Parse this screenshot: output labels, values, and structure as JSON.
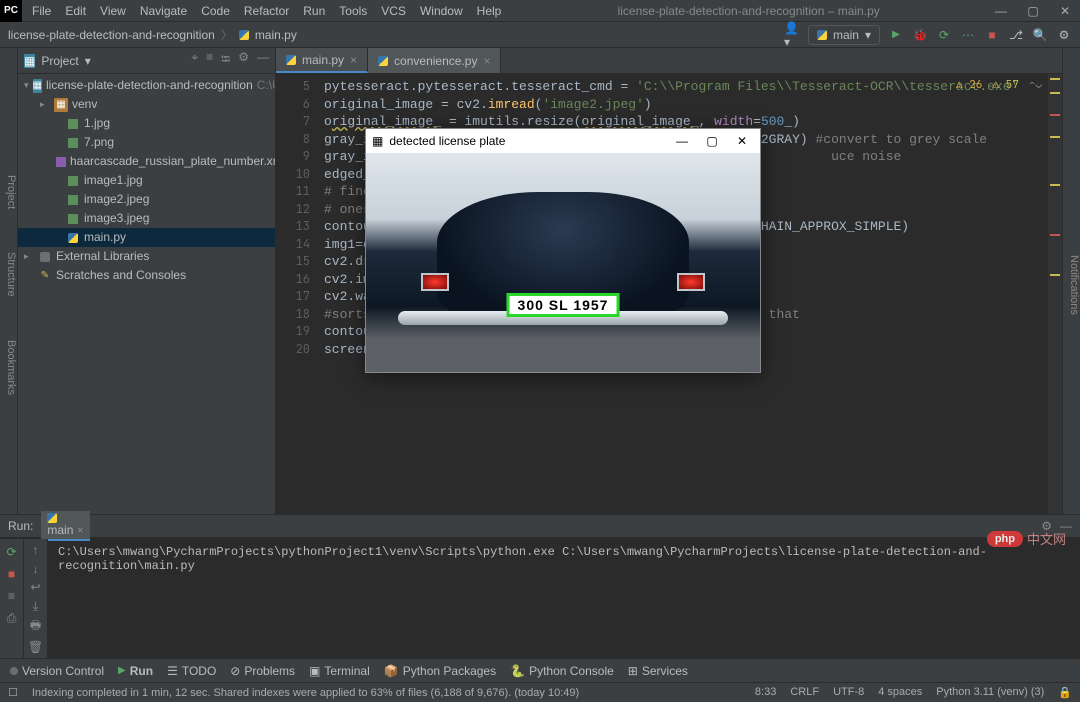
{
  "title": "license-plate-detection-and-recognition – main.py",
  "menubar": [
    "File",
    "Edit",
    "View",
    "Navigate",
    "Code",
    "Refactor",
    "Run",
    "Tools",
    "VCS",
    "Window",
    "Help"
  ],
  "breadcrumb": {
    "items": [
      "license-plate-detection-and-recognition",
      "main.py"
    ]
  },
  "run_config": {
    "label": "main"
  },
  "project": {
    "label": "Project",
    "root": {
      "name": "license-plate-detection-and-recognition",
      "hint": "C:\\Users\\m"
    },
    "children": [
      {
        "kind": "dir-orange",
        "name": "venv",
        "twisty": "▸"
      },
      {
        "kind": "img",
        "name": "1.jpg"
      },
      {
        "kind": "img",
        "name": "7.png"
      },
      {
        "kind": "xml",
        "name": "haarcascade_russian_plate_number.xml"
      },
      {
        "kind": "img",
        "name": "image1.jpg"
      },
      {
        "kind": "img",
        "name": "image2.jpeg"
      },
      {
        "kind": "img",
        "name": "image3.jpeg"
      },
      {
        "kind": "py",
        "name": "main.py",
        "selected": true
      }
    ],
    "ext_lib": "External Libraries",
    "scratches": "Scratches and Consoles"
  },
  "tabs": [
    {
      "name": "main.py",
      "icon": "py",
      "active": true
    },
    {
      "name": "convenience.py",
      "icon": "py",
      "active": false
    }
  ],
  "gutter_start": 5,
  "code_status": {
    "red": "26",
    "yellow": "57"
  },
  "code_lines_html": [
    "pytesseract.pytesseract.tesseract_cmd = <span class='str'>'C:\\\\Program Files\\\\Tesseract-OCR\\\\tesseract.exe'</span>",
    "original_image = cv2.<span class='fn'>imread</span>(<span class='str'>'image2.jpeg'</span>)",
    "o<span style='text-decoration:underline wavy #c9ba54'>riginal_image_</span> = imutils.resize(<span style='text-decoration:underline wavy #c9ba54'>original_image_</span>, <span class='nm'>width</span>=<span class='num'>500</span>_)",
    "gray_image = cv2.cvtColor(original_image_, cv2.COLOR_BGR2GRAY) <span class='com'>#convert to grey scale</span>",
    "gray_i                                                           <span class='com'>uce noise</span>",
    "edged_",
    "<span class='com'># find</span>",
    "<span class='com'># ones</span>",
    "contou                                              v2.CHAIN_APPROX_SIMPLE)",
    "img1=c",
    "cv2.dr",
    "cv2.im",
    "cv2.wa",
    "<span class='com'>#sorts                                                   that</span>",
    "contou                                              <span class='num'>0</span>]",
    "screen"
  ],
  "run_panel": {
    "title": "Run:",
    "tab": "main",
    "output": "C:\\Users\\mwang\\PycharmProjects\\pythonProject1\\venv\\Scripts\\python.exe C:\\Users\\mwang\\PycharmProjects\\license-plate-detection-and-recognition\\main.py"
  },
  "left_strip": [
    "Project",
    "Bookmarks",
    "Structure"
  ],
  "right_strip": "Notifications",
  "toolstrip": [
    "Version Control",
    "Run",
    "TODO",
    "Problems",
    "Terminal",
    "Python Packages",
    "Python Console",
    "Services"
  ],
  "statusbar": {
    "msg": "Indexing completed in 1 min, 12 sec. Shared indexes were applied to 63% of files (6,188 of 9,676). (today 10:49)",
    "pos": "8:33",
    "eol": "CRLF",
    "enc": "UTF-8",
    "indent": "4 spaces",
    "python": "Python 3.11 (venv) (3)"
  },
  "cv_window": {
    "title": "detected license plate",
    "plate_text": "300 SL 1957"
  },
  "watermark": {
    "pill": "php",
    "cn": "中文网"
  }
}
